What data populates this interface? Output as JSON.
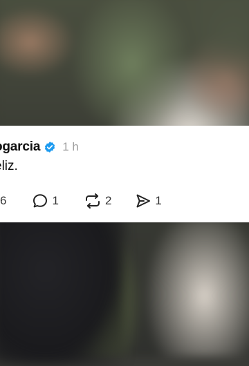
{
  "post": {
    "username": "ogarcia",
    "time": "1 h",
    "text": "eliz."
  },
  "actions": {
    "likes": "6",
    "replies": "1",
    "reposts": "2",
    "shares": "1"
  },
  "colors": {
    "verified": "#1d9bf0",
    "muted": "#a0a0a0",
    "text": "#101010"
  }
}
